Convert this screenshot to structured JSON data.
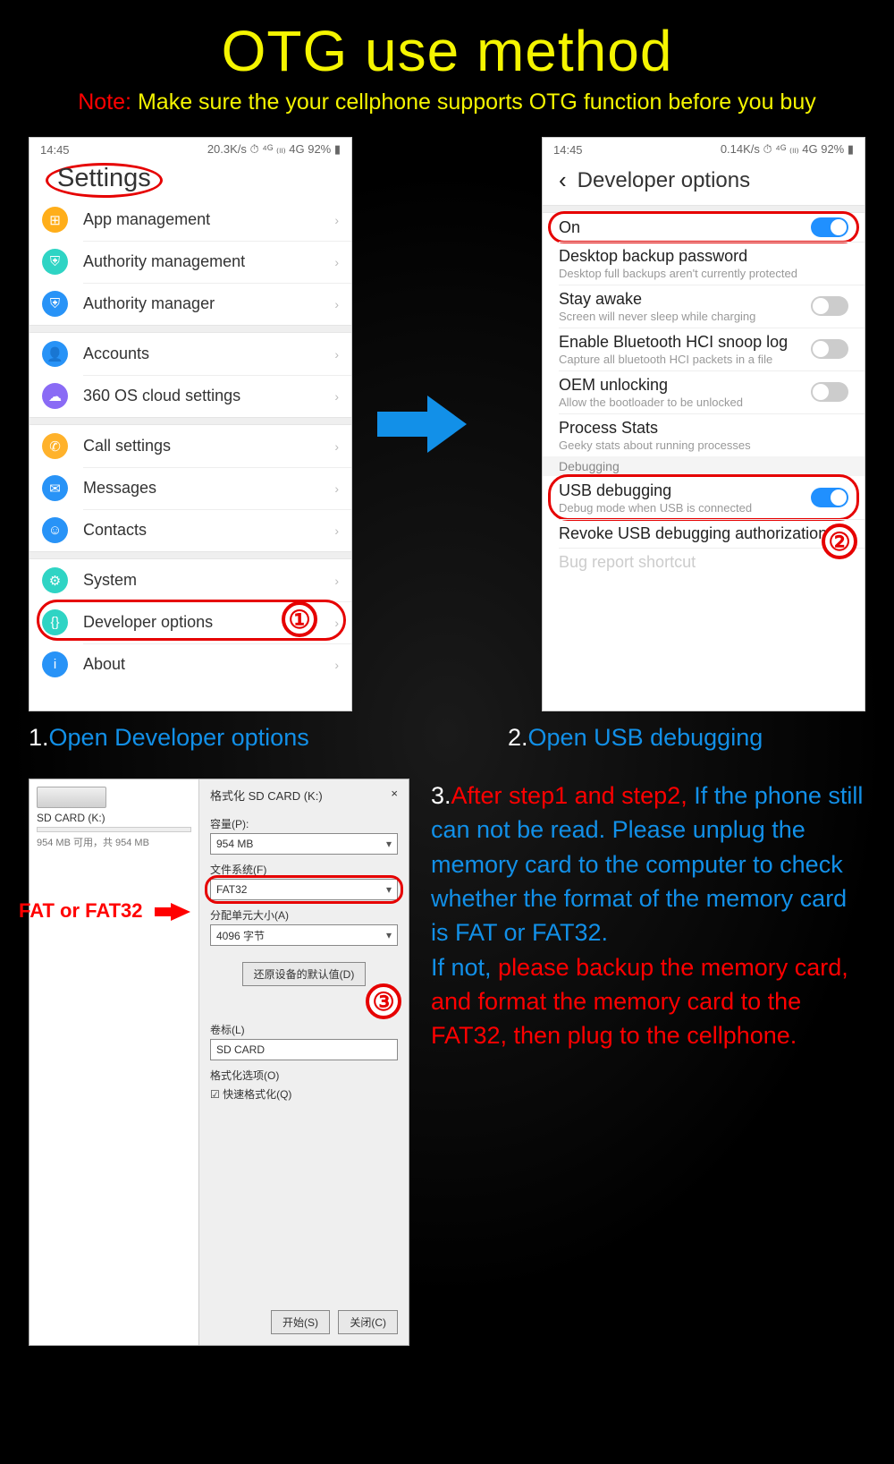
{
  "title": "OTG use method",
  "note_label": "Note:",
  "note_text": "Make sure the your cellphone supports OTG function before you buy",
  "status": {
    "time": "14:45",
    "speed1": "20.3K/s",
    "speed2": "0.14K/s",
    "right": "⏱ ⁴ᴳ ₍ₗₗ₎ 4G 92% ▮"
  },
  "phone1": {
    "header": "Settings",
    "groups": [
      [
        {
          "icon": "orange",
          "glyph": "⊞",
          "label": "App management"
        },
        {
          "icon": "teal",
          "glyph": "⛨",
          "label": "Authority management"
        },
        {
          "icon": "blue",
          "glyph": "⛨",
          "label": "Authority manager"
        }
      ],
      [
        {
          "icon": "blue",
          "glyph": "👤",
          "label": "Accounts"
        },
        {
          "icon": "purple",
          "glyph": "☁",
          "label": "360 OS cloud settings"
        }
      ],
      [
        {
          "icon": "yellowcall",
          "glyph": "✆",
          "label": "Call settings"
        },
        {
          "icon": "msg",
          "glyph": "✉",
          "label": "Messages"
        },
        {
          "icon": "contacts",
          "glyph": "☺",
          "label": "Contacts"
        }
      ],
      [
        {
          "icon": "gear",
          "glyph": "⚙",
          "label": "System"
        },
        {
          "icon": "dev",
          "glyph": "{}",
          "label": "Developer options"
        },
        {
          "icon": "info",
          "glyph": "i",
          "label": "About"
        }
      ]
    ]
  },
  "phone2": {
    "header": "Developer options",
    "items": [
      {
        "main": "On",
        "sub": "",
        "toggle": "on",
        "outlined": true
      },
      {
        "main": "Desktop backup password",
        "sub": "Desktop full backups aren't currently protected"
      },
      {
        "main": "Stay awake",
        "sub": "Screen will never sleep while charging",
        "toggle": "off"
      },
      {
        "main": "Enable Bluetooth HCI snoop log",
        "sub": "Capture all bluetooth HCI packets in a file",
        "toggle": "off"
      },
      {
        "main": "OEM unlocking",
        "sub": "Allow the bootloader to be unlocked",
        "toggle": "off"
      },
      {
        "main": "Process Stats",
        "sub": "Geeky stats about running processes"
      }
    ],
    "section_label": "Debugging",
    "items2": [
      {
        "main": "USB debugging",
        "sub": "Debug mode when USB is connected",
        "toggle": "on",
        "outlined": true
      },
      {
        "main": "Revoke USB debugging authorizations",
        "sub": ""
      },
      {
        "main": "Bug report shortcut",
        "sub": "",
        "faded": true
      }
    ]
  },
  "caption1_num": "1.",
  "caption1_txt": "Open Developer options",
  "caption2_num": "2.",
  "caption2_txt": "Open USB debugging",
  "win": {
    "left_title": "SD CARD (K:)",
    "left_sub": "954 MB 可用，共 954 MB",
    "title": "格式化 SD CARD (K:)",
    "close": "×",
    "capacity_label": "容量(P):",
    "capacity_value": "954 MB",
    "fs_label": "文件系统(F)",
    "fs_value": "FAT32",
    "alloc_label": "分配单元大小(A)",
    "alloc_value": "4096 字节",
    "restore_btn": "还原设备的默认值(D)",
    "vol_label": "卷标(L)",
    "vol_value": "SD CARD",
    "fmt_opts_label": "格式化选项(O)",
    "quick_fmt": "快速格式化(Q)",
    "start_btn": "开始(S)",
    "close_btn": "关闭(C)"
  },
  "fat_label": "FAT or FAT32",
  "step3": {
    "num": "3.",
    "red1": "After step1 and step2,",
    "blue1": "If the phone still can not be read. Please unplug the memory card to the computer to check whether the format of the memory card is FAT or FAT32.",
    "blue2": "If not, ",
    "red2": "please backup the memory card, and format the memory card to the FAT32, then plug to the cellphone."
  },
  "marks": {
    "one": "①",
    "two": "②",
    "three": "③"
  }
}
